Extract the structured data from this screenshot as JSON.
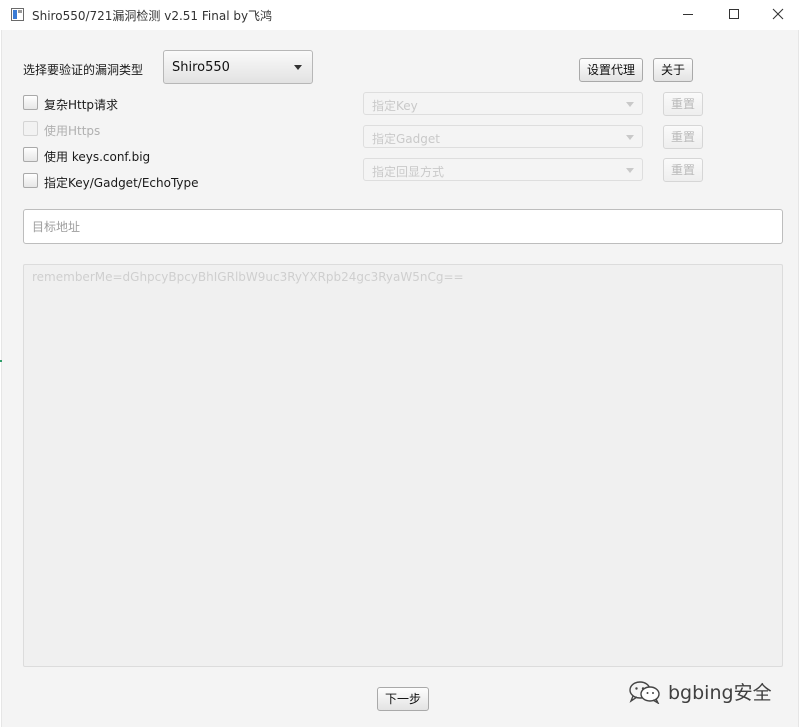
{
  "window": {
    "title": "Shiro550/721漏洞检测 v2.51 Final  by飞鸿",
    "icon": "app-window-icon",
    "controls": [
      "minimize-icon",
      "maximize-icon",
      "close-icon"
    ]
  },
  "vuln_type": {
    "label": "选择要验证的漏洞类型",
    "selected": "Shiro550"
  },
  "buttons": {
    "proxy": "设置代理",
    "about": "关于",
    "next": "下一步"
  },
  "options": [
    {
      "label": "复杂Http请求",
      "checked": false,
      "enabled": true
    },
    {
      "label": "使用Https",
      "checked": false,
      "enabled": false
    },
    {
      "label": "使用 keys.conf.big",
      "checked": false,
      "enabled": true
    },
    {
      "label": "指定Key/Gadget/EchoType",
      "checked": false,
      "enabled": true
    }
  ],
  "selectors": [
    {
      "placeholder": "指定Key",
      "reset": "重置"
    },
    {
      "placeholder": "指定Gadget",
      "reset": "重置"
    },
    {
      "placeholder": "指定回显方式",
      "reset": "重置"
    }
  ],
  "target": {
    "placeholder": "目标地址",
    "value": ""
  },
  "output": {
    "placeholder": "rememberMe=dGhpcyBpcyBhIGRlbW9uc3RyYXRpb24gc3RyaW5nCg=="
  },
  "watermark": {
    "text": "bgbing安全",
    "icon": "wechat-icon"
  }
}
